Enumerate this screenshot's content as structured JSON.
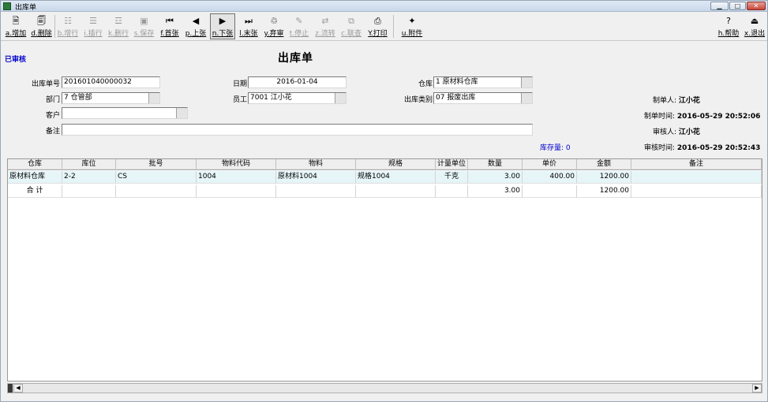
{
  "window": {
    "title": "出库单",
    "btn_min": "▁",
    "btn_max": "□",
    "btn_close": "✕"
  },
  "toolbar": {
    "add": "a.增加",
    "delete": "d.删除",
    "add_line": "b.增行",
    "insert_line": "i.插行",
    "delete_line": "k.删行",
    "save": "s.保存",
    "first": "f.首张",
    "prev": "p.上张",
    "next": "n.下张",
    "last": "l.末张",
    "unapprove": "y.弃审",
    "stop": "t.停止",
    "transfer": "z.流转",
    "link": "c.联查",
    "print": "Y.打印",
    "attach": "u.附件",
    "help": "h.帮助",
    "exit": "x.退出"
  },
  "status": "已审核",
  "doc_title": "出库单",
  "header": {
    "doc_no_label": "出库单号",
    "doc_no": "201601040000032",
    "date_label": "日期",
    "date": "2016-01-04",
    "warehouse_label": "仓库",
    "warehouse": "1 原材料仓库",
    "dept_label": "部门",
    "dept": "7 仓管部",
    "staff_label": "员工",
    "staff": "7001 江小花",
    "out_type_label": "出库类别",
    "out_type": "07 报废出库",
    "customer_label": "客户",
    "customer": "",
    "remark_label": "备注",
    "remark": ""
  },
  "side": {
    "maker_label": "制单人:",
    "maker": "江小花",
    "make_time_label": "制单时间:",
    "make_time": "2016-05-29 20:52:06",
    "auditor_label": "审核人:",
    "auditor": "江小花",
    "audit_time_label": "审核时间:",
    "audit_time": "2016-05-29 20:52:43"
  },
  "stock": {
    "label": "库存量:",
    "value": "0"
  },
  "grid": {
    "columns": [
      "仓库",
      "库位",
      "批号",
      "物料代码",
      "物料",
      "规格",
      "计量单位",
      "数量",
      "单价",
      "金额",
      "备注"
    ],
    "rows": [
      [
        "原材料仓库",
        "2-2",
        "CS",
        "1004",
        "原材料1004",
        "规格1004",
        "千克",
        "3.00",
        "400.00",
        "1200.00",
        ""
      ]
    ],
    "total": {
      "label": "合 计",
      "qty": "3.00",
      "amount": "1200.00"
    }
  }
}
